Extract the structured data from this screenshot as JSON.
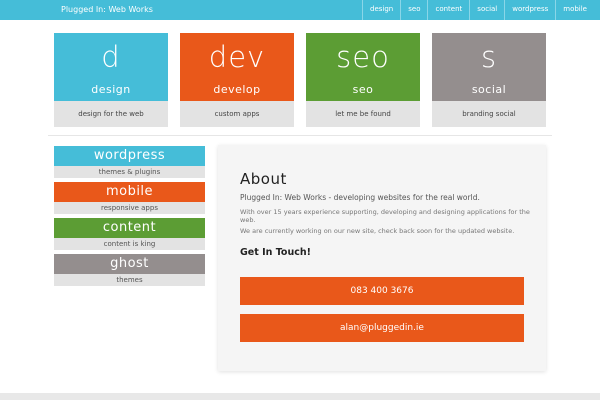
{
  "header": {
    "brand": "Plugged In: Web Works",
    "nav": [
      "design",
      "seo",
      "content",
      "social",
      "wordpress",
      "mobile"
    ]
  },
  "tiles": [
    {
      "big": "d",
      "small": "design",
      "caption": "design for the web",
      "color": "#45bdd8"
    },
    {
      "big": "dev",
      "small": "develop",
      "caption": "custom apps",
      "color": "#e9581a"
    },
    {
      "big": "seo",
      "small": "seo",
      "caption": "let me be found",
      "color": "#5c9d34"
    },
    {
      "big": "s",
      "small": "social",
      "caption": "branding social",
      "color": "#948e8e"
    }
  ],
  "sidebar": [
    {
      "title": "wordpress",
      "sub": "themes & plugins",
      "color": "#45bdd8"
    },
    {
      "title": "mobile",
      "sub": "responsive apps",
      "color": "#e9581a"
    },
    {
      "title": "content",
      "sub": "content is king",
      "color": "#5c9d34"
    },
    {
      "title": "ghost",
      "sub": "themes",
      "color": "#948e8e"
    }
  ],
  "about": {
    "title": "About",
    "tagline": "Plugged In: Web Works - developing websites for the real world.",
    "p1": "With over 15 years experience supporting, developing and designing applications for the web.",
    "p2": "We are currently working on our new site, check back soon for the updated website.",
    "contact_heading": "Get In Touch!",
    "phone": "083 400 3676",
    "email": "alan@pluggedin.ie",
    "button_color": "#e9581a"
  }
}
